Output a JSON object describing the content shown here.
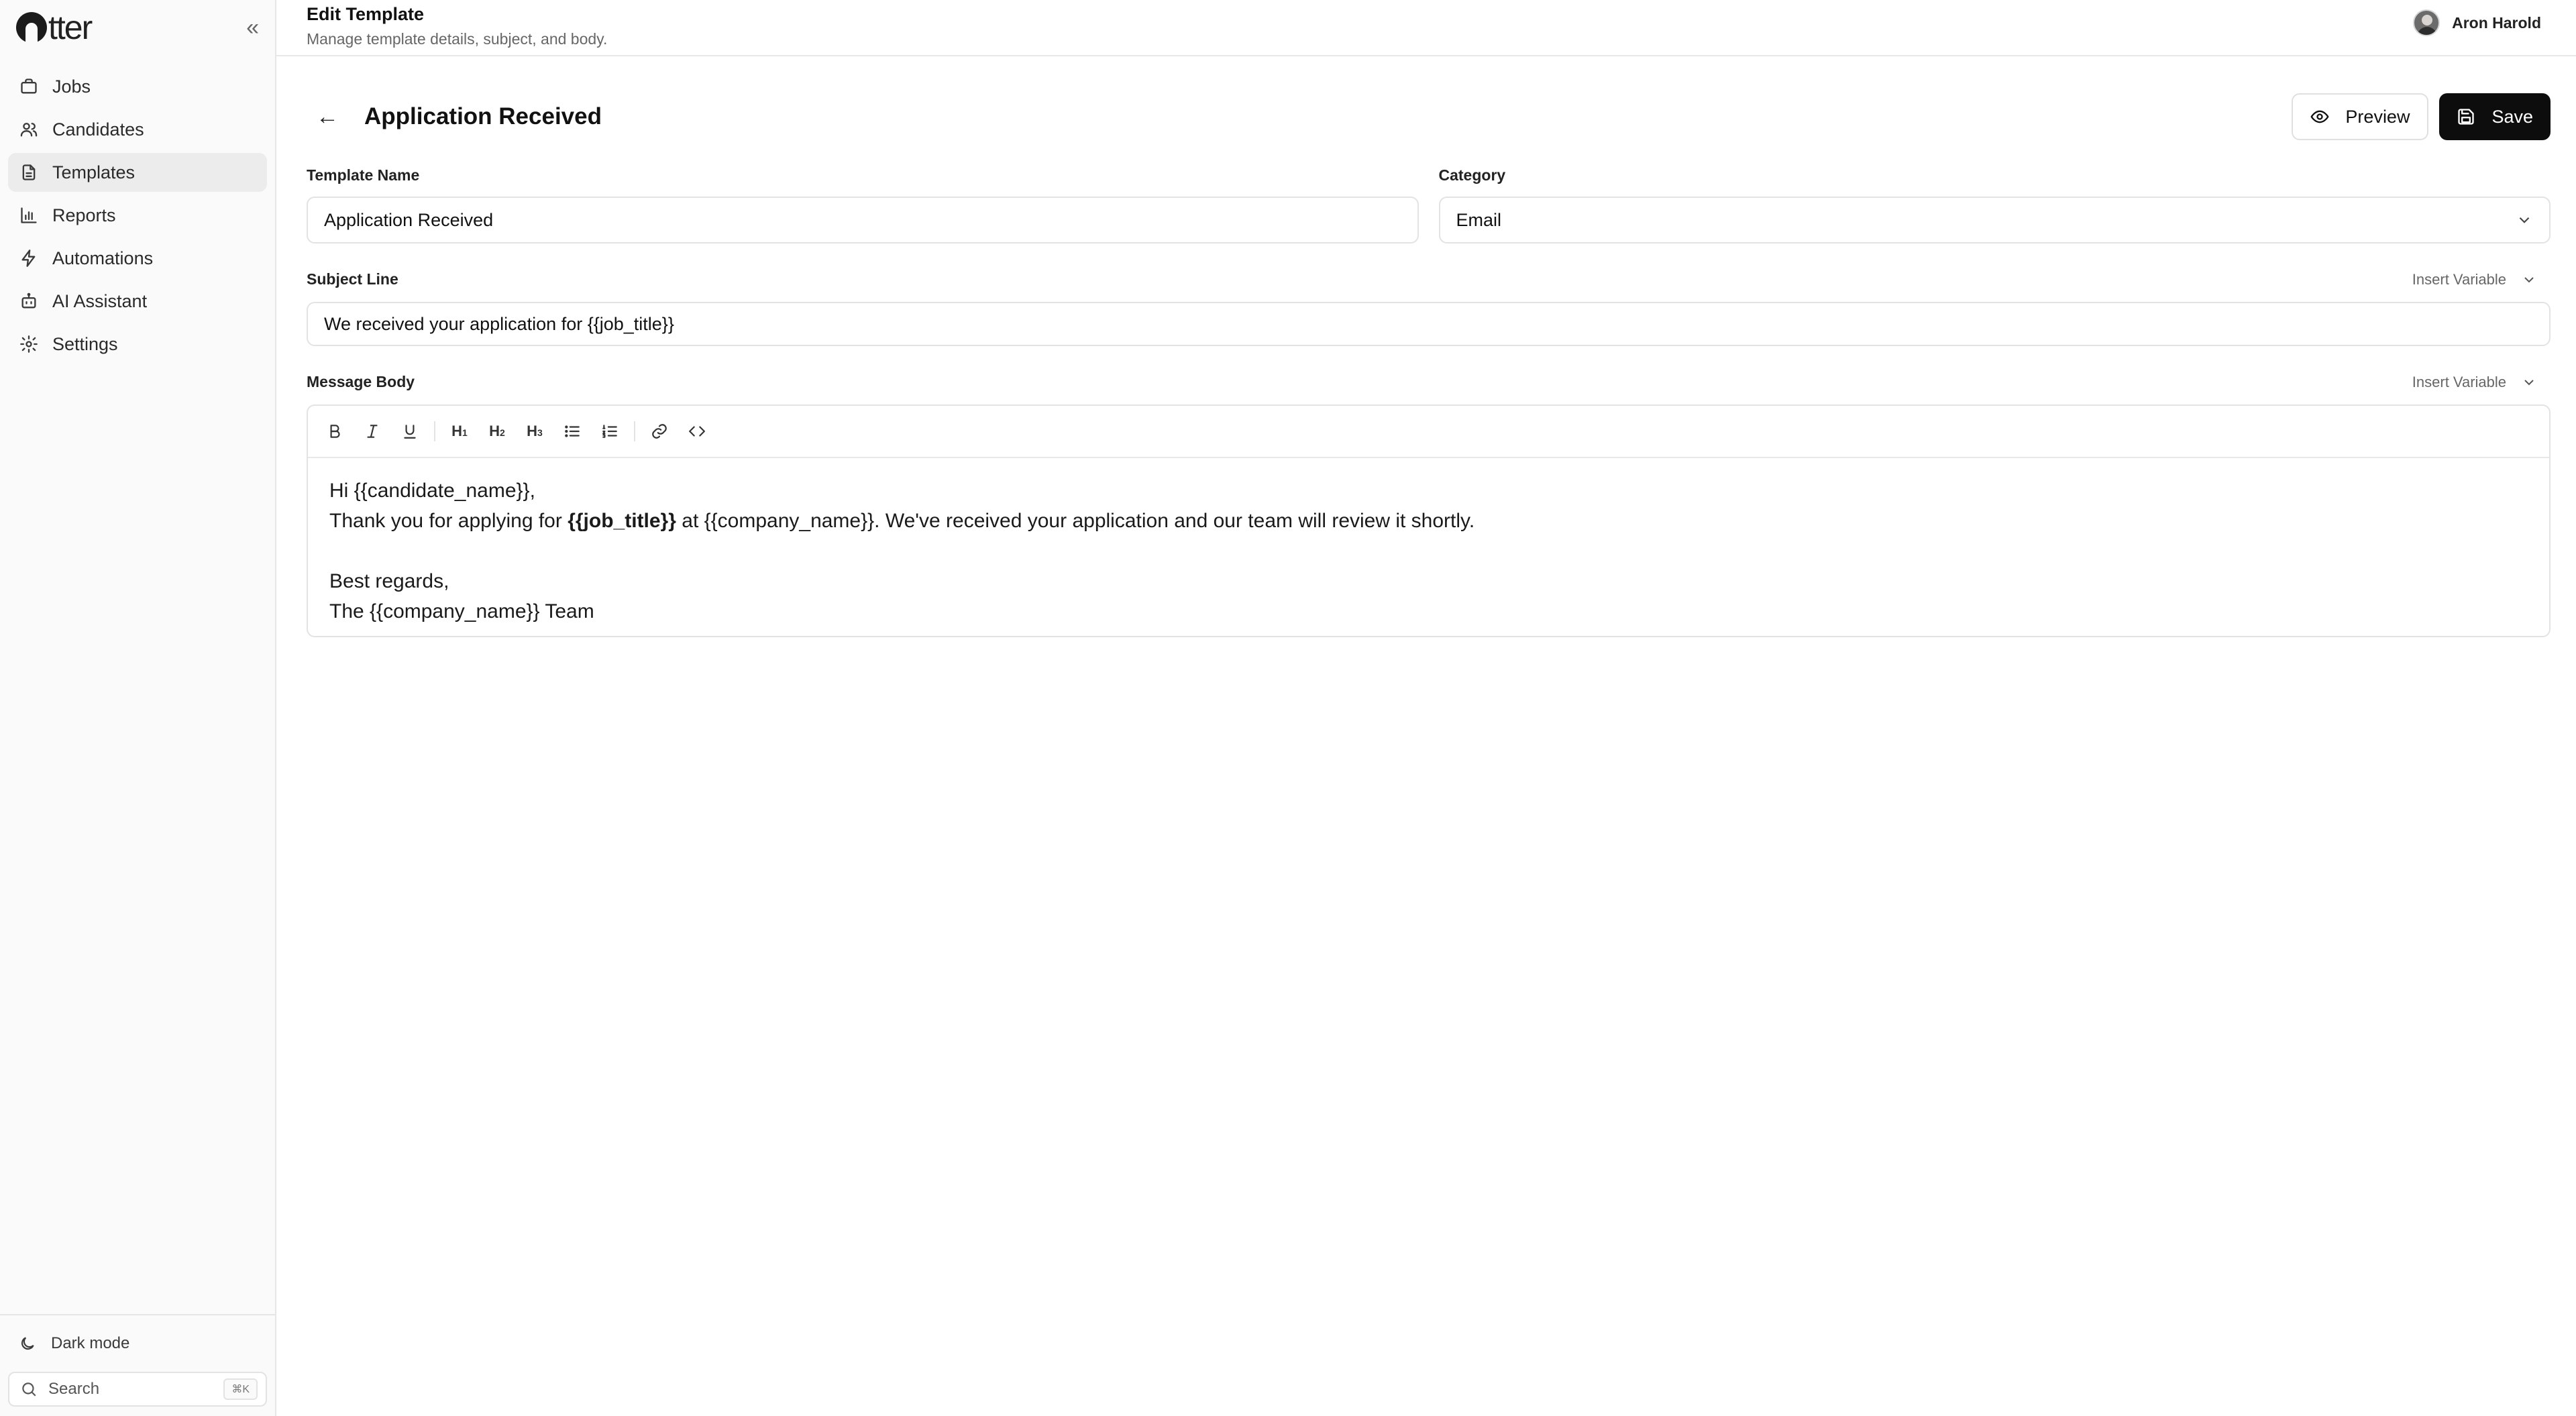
{
  "sidebar": {
    "logo_text": "tter",
    "collapse_glyph": "«",
    "nav": [
      {
        "label": "Jobs",
        "icon": "briefcase-icon",
        "active": false
      },
      {
        "label": "Candidates",
        "icon": "users-icon",
        "active": false
      },
      {
        "label": "Templates",
        "icon": "file-text-icon",
        "active": true
      },
      {
        "label": "Reports",
        "icon": "bar-chart-icon",
        "active": false
      },
      {
        "label": "Automations",
        "icon": "zap-icon",
        "active": false
      },
      {
        "label": "AI Assistant",
        "icon": "bot-icon",
        "active": false
      },
      {
        "label": "Settings",
        "icon": "gear-icon",
        "active": false
      }
    ],
    "dark_mode_label": "Dark mode",
    "search_placeholder": "Search",
    "search_shortcut": "⌘K"
  },
  "topbar": {
    "title": "Edit Template",
    "subtitle": "Manage template details, subject, and body.",
    "user_name": "Aron Harold"
  },
  "page": {
    "title": "Application Received",
    "preview_label": "Preview",
    "save_label": "Save"
  },
  "form": {
    "template_name_label": "Template Name",
    "template_name_value": "Application Received",
    "category_label": "Category",
    "category_value": "Email",
    "subject_label": "Subject Line",
    "subject_insert_label": "Insert Variable",
    "subject_value": "We received your application for {{job_title}}",
    "body_label": "Message Body",
    "body_insert_label": "Insert Variable"
  },
  "editor": {
    "toolbar": [
      "bold",
      "italic",
      "underline",
      "H1",
      "H2",
      "H3",
      "bullet-list",
      "numbered-list",
      "link",
      "code"
    ],
    "line1": "Hi {{candidate_name}},",
    "line2_pre": "Thank you for applying for ",
    "line2_bold": "{{job_title}}",
    "line2_post": " at {{company_name}}. We've received your application and our team will review it shortly.",
    "line3": "Best regards,",
    "line4": "The {{company_name}} Team"
  },
  "colors": {
    "accent_dark": "#0d0d0d",
    "sidebar_bg": "#fafafa",
    "active_nav_bg": "#ececec"
  }
}
